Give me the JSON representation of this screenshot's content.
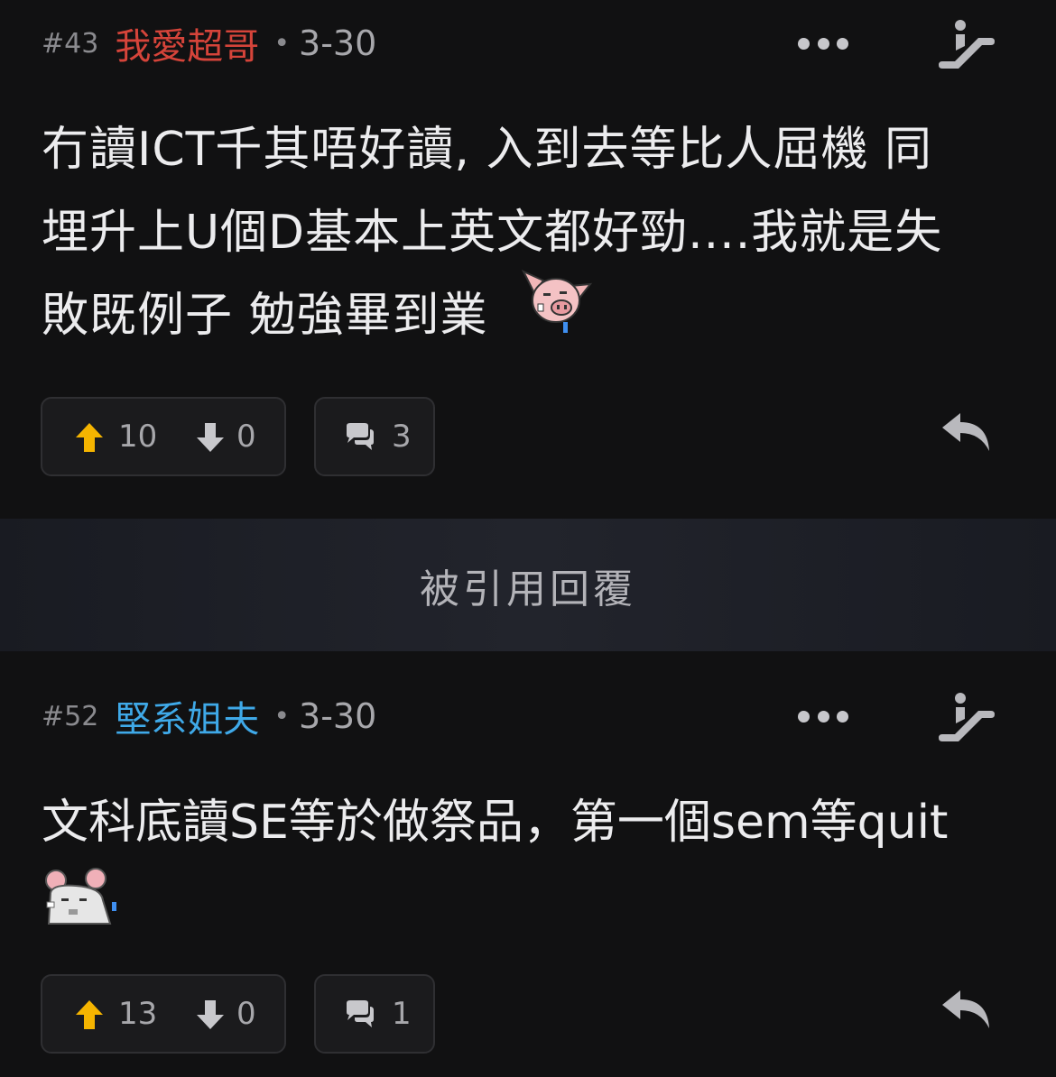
{
  "posts": [
    {
      "floor": "#43",
      "username": "我愛超哥",
      "username_color": "#d5443a",
      "separator": "•",
      "date": "3-30",
      "content_lines": [
        "冇讀ICT千其唔好讀, 入到去等比人屈機 同",
        "埋升上U個D基本上英文都好勁....我就是失",
        "敗既例子 勉強畢到業"
      ],
      "emoji": "pig-crying-emoji",
      "upvotes": "10",
      "downvotes": "0",
      "replies": "3"
    },
    {
      "floor": "#52",
      "username": "堅系姐夫",
      "username_color": "#3fa9e8",
      "separator": "•",
      "date": "3-30",
      "content_lines": [
        "文科底讀SE等於做祭品，第一個sem等quit"
      ],
      "emoji": "mouse-crying-emoji",
      "upvotes": "13",
      "downvotes": "0",
      "replies": "1"
    }
  ],
  "quoted_bar": {
    "label": "被引用回覆"
  },
  "icons": {
    "more": "more-dots-icon",
    "escalator": "escalator-icon",
    "upvote": "arrow-up-icon",
    "downvote": "arrow-down-icon",
    "comment": "comment-bubbles-icon",
    "reply": "reply-arrow-icon"
  },
  "colors": {
    "upvote": "#f5b400",
    "background": "#111112"
  }
}
